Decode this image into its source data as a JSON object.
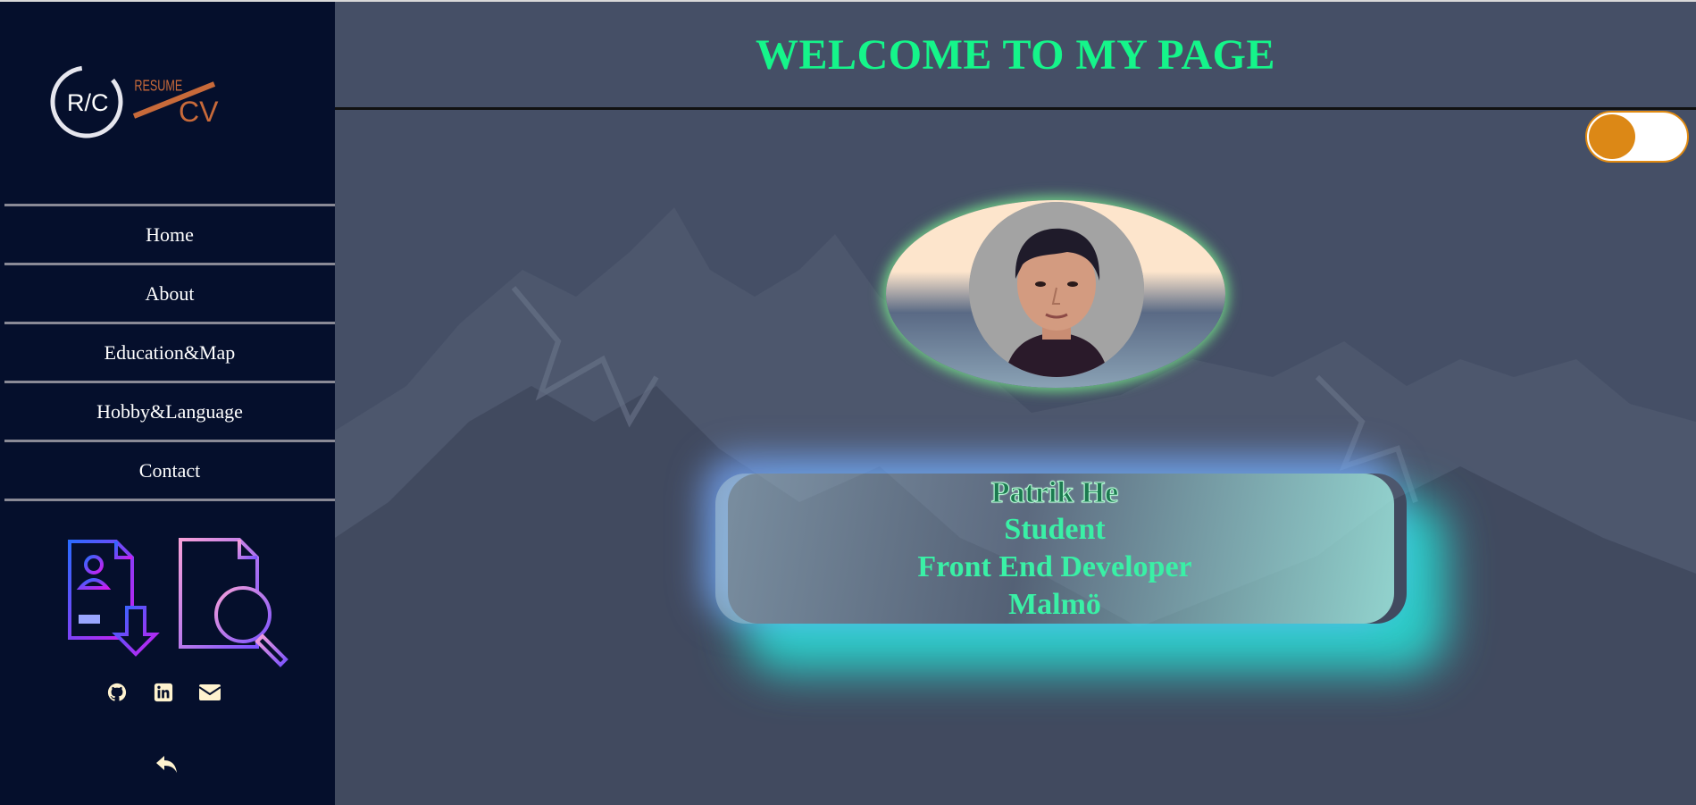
{
  "sidebar": {
    "logo": {
      "initials": "R/C",
      "word_top": "RESUME",
      "word_bottom": "CV"
    },
    "nav": [
      {
        "label": "Home"
      },
      {
        "label": "About"
      },
      {
        "label": "Education&Map"
      },
      {
        "label": "Hobby&Language"
      },
      {
        "label": "Contact"
      }
    ],
    "illustrations": [
      "resume-download-icon",
      "document-search-icon"
    ],
    "social": [
      "github-icon",
      "linkedin-icon",
      "mail-icon"
    ],
    "back_icon": "reply-arrow-icon"
  },
  "header": {
    "title": "WELCOME TO MY PAGE"
  },
  "theme_toggle": {
    "state": "off"
  },
  "profile": {
    "name": "Patrik He",
    "role": "Student",
    "title": "Front End Developer",
    "city": "Malmö"
  },
  "colors": {
    "sidebar_bg": "#050f2c",
    "main_bg": "#454f66",
    "title": "#15f58a",
    "toggle_knob": "#dc8816",
    "card_text": "#3af0a6"
  }
}
